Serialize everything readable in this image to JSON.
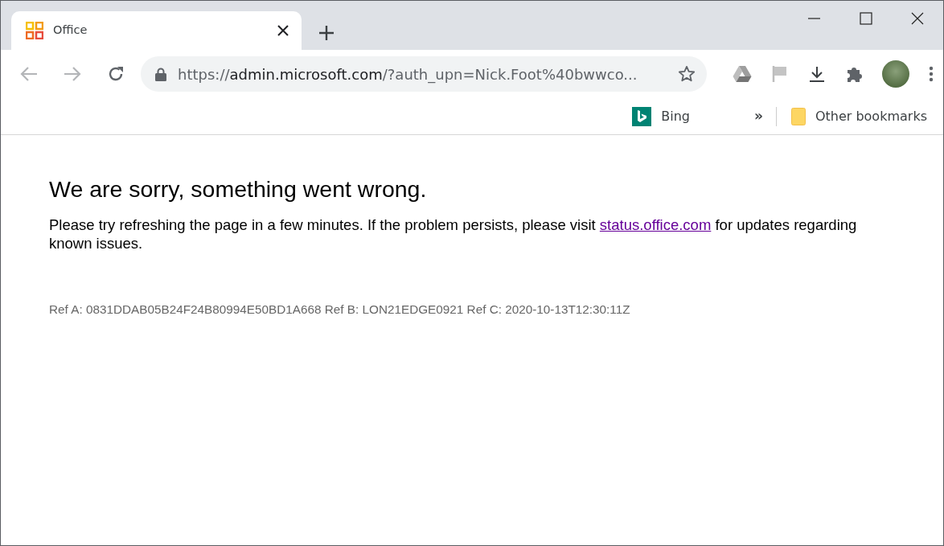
{
  "tab": {
    "title": "Office",
    "selected": true
  },
  "address_bar": {
    "scheme": "https://",
    "host": "admin.microsoft.com",
    "rest": "/?auth_upn=Nick.Foot%40bwwco..."
  },
  "bookmarks": [
    {
      "label": "Bing",
      "kind": "bing"
    },
    {
      "label": "Other bookmarks",
      "kind": "folder"
    }
  ],
  "overflow": "»",
  "page": {
    "heading": "We are sorry, something went wrong.",
    "message": {
      "before": "Please try refreshing the page in a few minutes. If the problem persists, please visit ",
      "link": "status.office.com",
      "after": " for updates regarding known issues."
    },
    "reference": "Ref A: 0831DDAB05B24F24B80994E50BD1A668 Ref B: LON21EDGE0921 Ref C: 2020-10-13T12:30:11Z"
  }
}
